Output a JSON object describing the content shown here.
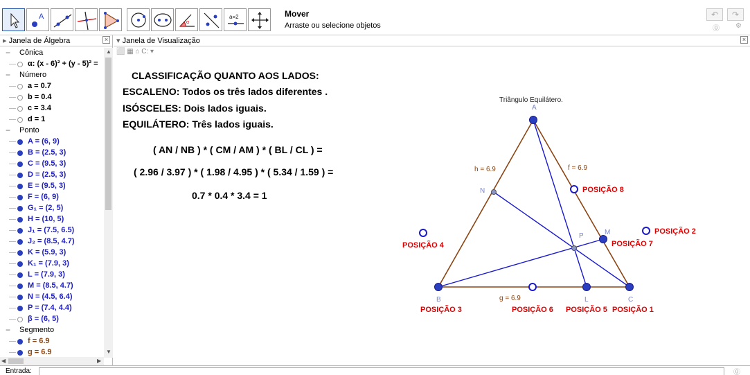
{
  "toolbar": {
    "tools": [
      {
        "name": "move-tool-button",
        "icon": "cursor-arrow-icon"
      },
      {
        "name": "point-tool-button",
        "icon": "point-a-icon"
      },
      {
        "name": "line-tool-button",
        "icon": "line-icon"
      },
      {
        "name": "perpendicular-tool-button",
        "icon": "perpendicular-icon"
      },
      {
        "name": "polygon-tool-button",
        "icon": "polygon-icon"
      },
      {
        "name": "circle-tool-button",
        "icon": "circle-center-icon"
      },
      {
        "name": "conic-tool-button",
        "icon": "ellipse-icon"
      },
      {
        "name": "angle-tool-button",
        "icon": "angle-icon"
      },
      {
        "name": "reflect-tool-button",
        "icon": "reflect-icon"
      },
      {
        "name": "slider-tool-button",
        "icon": "slider-icon"
      },
      {
        "name": "move-view-tool-button",
        "icon": "move-arrows-icon"
      }
    ],
    "slider_label": "a=2",
    "title": "Mover",
    "help": "Arraste ou selecione objetos",
    "undo": "↶",
    "redo": "↷",
    "help_icon": "⓪",
    "settings_icon": "⚙"
  },
  "algebra": {
    "title": "Janela de Álgebra",
    "close": "×",
    "rows": [
      {
        "type": "cat",
        "text": "Cônica"
      },
      {
        "type": "item",
        "text": "α: (x - 6)² + (y - 5)² = ",
        "color": "#000000",
        "dot": "hollow"
      },
      {
        "type": "cat",
        "text": "Número"
      },
      {
        "type": "item",
        "text": "a = 0.7",
        "color": "#000000",
        "dot": "hollow"
      },
      {
        "type": "item",
        "text": "b = 0.4",
        "color": "#000000",
        "dot": "hollow"
      },
      {
        "type": "item",
        "text": "c = 3.4",
        "color": "#000000",
        "dot": "hollow"
      },
      {
        "type": "item",
        "text": "d = 1",
        "color": "#000000",
        "dot": "hollow"
      },
      {
        "type": "cat",
        "text": "Ponto"
      },
      {
        "type": "item",
        "text": "A = (6, 9)",
        "color": "#2020c0",
        "dot": "filled"
      },
      {
        "type": "item",
        "text": "B = (2.5, 3)",
        "color": "#2020c0",
        "dot": "filled"
      },
      {
        "type": "item",
        "text": "C = (9.5, 3)",
        "color": "#2020c0",
        "dot": "filled"
      },
      {
        "type": "item",
        "text": "D = (2.5, 3)",
        "color": "#2020c0",
        "dot": "filled"
      },
      {
        "type": "item",
        "text": "E = (9.5, 3)",
        "color": "#2020c0",
        "dot": "filled"
      },
      {
        "type": "item",
        "text": "F = (6, 9)",
        "color": "#2020c0",
        "dot": "filled"
      },
      {
        "type": "item",
        "text": "G₁ = (2, 5)",
        "color": "#2020c0",
        "dot": "filled"
      },
      {
        "type": "item",
        "text": "H = (10, 5)",
        "color": "#2020c0",
        "dot": "filled"
      },
      {
        "type": "item",
        "text": "J₁ = (7.5, 6.5)",
        "color": "#2020c0",
        "dot": "filled"
      },
      {
        "type": "item",
        "text": "J₂ = (8.5, 4.7)",
        "color": "#2020c0",
        "dot": "filled"
      },
      {
        "type": "item",
        "text": "K = (5.9, 3)",
        "color": "#2020c0",
        "dot": "filled"
      },
      {
        "type": "item",
        "text": "K₁ = (7.9, 3)",
        "color": "#2020c0",
        "dot": "filled"
      },
      {
        "type": "item",
        "text": "L = (7.9, 3)",
        "color": "#2020c0",
        "dot": "filled"
      },
      {
        "type": "item",
        "text": "M = (8.5, 4.7)",
        "color": "#2020c0",
        "dot": "filled"
      },
      {
        "type": "item",
        "text": "N = (4.5, 6.4)",
        "color": "#2020c0",
        "dot": "filled"
      },
      {
        "type": "item",
        "text": "P = (7.4, 4.4)",
        "color": "#2020c0",
        "dot": "filled"
      },
      {
        "type": "item",
        "text": "β = (6, 5)",
        "color": "#2020c0",
        "dot": "hollow"
      },
      {
        "type": "cat",
        "text": "Segmento"
      },
      {
        "type": "item",
        "text": "f = 6.9",
        "color": "#8b4513",
        "dot": "filled-brown"
      },
      {
        "type": "item",
        "text": "g = 6.9",
        "color": "#8b4513",
        "dot": "filled-brown"
      }
    ]
  },
  "graphics": {
    "title": "Janela de Visualização",
    "close": "×",
    "style_bar": "⬜ ▦ ⌂ C: ▾",
    "text_lines": [
      "CLASSIFICAÇÃO QUANTO AOS LADOS:",
      "ESCALENO: Todos os três lados diferentes .",
      "ISÓSCELES: Dois lados iguais.",
      "EQUILÁTERO: Três lados iguais."
    ],
    "formula_lines": [
      "( AN / NB ) * ( CM / AM ) * ( BL / CL ) =",
      "( 2.96 / 3.97 ) * ( 1.98 / 4.95 ) * ( 5.34 / 1.59 ) =",
      "0.7 * 0.4 * 3.4 = 1"
    ],
    "triangle_caption": "Triângulo Equilátero.",
    "labels": {
      "A": "A",
      "B": "B",
      "C": "C",
      "N": "N",
      "M": "M",
      "P": "P",
      "L": "L",
      "h": "h = 6.9",
      "f": "f = 6.9",
      "g": "g = 6.9"
    },
    "positions": [
      "POSIÇÃO 1",
      "POSIÇÃO 2",
      "POSIÇÃO 3",
      "POSIÇÃO 4",
      "POSIÇÃO 5",
      "POSIÇÃO 6",
      "POSIÇÃO 7",
      "POSIÇÃO 8"
    ],
    "colors": {
      "segment": "#8b4513",
      "cevian": "#1a1acc",
      "point": "#2a3fbf",
      "position": "#e00000"
    }
  },
  "input": {
    "label": "Entrada:",
    "value": "",
    "help": "⓪"
  }
}
